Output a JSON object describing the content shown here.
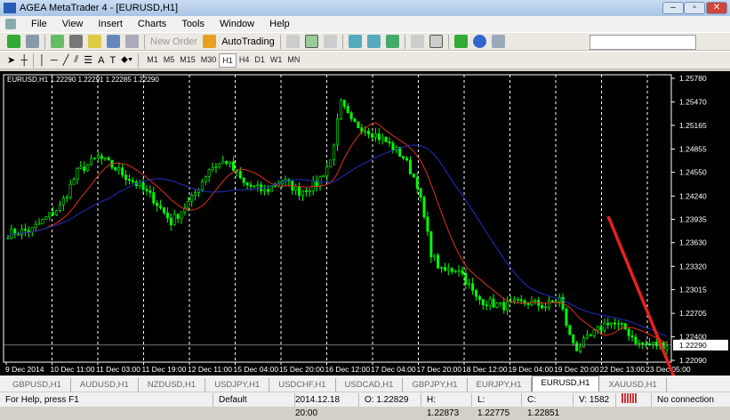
{
  "window": {
    "title": "AGEA MetaTrader 4 - [EURUSD,H1]"
  },
  "menu": [
    "File",
    "View",
    "Insert",
    "Charts",
    "Tools",
    "Window",
    "Help"
  ],
  "toolbar": {
    "new_order": "New Order",
    "autotrading": "AutoTrading",
    "timeframes": [
      "M1",
      "M5",
      "M15",
      "M30",
      "H1",
      "H4",
      "D1",
      "W1",
      "MN"
    ],
    "active_timeframe": "H1",
    "drawing_tools": [
      "cursor",
      "crosshair",
      "vertical-line",
      "horizontal-line",
      "trendline",
      "equidistant-channel",
      "fibonacci",
      "text",
      "text-label",
      "arrows"
    ]
  },
  "chart_data": {
    "type": "candlestick",
    "symbol_info": "EURUSD,H1  1.22290 1.22291 1.22285 1.22290",
    "ylim": [
      1.22,
      1.259
    ],
    "y_ticks": [
      "1.25780",
      "1.25470",
      "1.25165",
      "1.24855",
      "1.24550",
      "1.24240",
      "1.23935",
      "1.23630",
      "1.23320",
      "1.23015",
      "1.22705",
      "1.22400",
      "1.22090"
    ],
    "current_price": "1.22290",
    "x_ticks": [
      "9 Dec 2014",
      "10 Dec 11:00",
      "11 Dec 03:00",
      "11 Dec 19:00",
      "12 Dec 11:00",
      "15 Dec 04:00",
      "15 Dec 20:00",
      "16 Dec 12:00",
      "17 Dec 04:00",
      "17 Dec 20:00",
      "18 Dec 12:00",
      "19 Dec 04:00",
      "19 Dec 20:00",
      "22 Dec 13:00",
      "23 Dec 05:00"
    ],
    "close_path": [
      [
        0,
        1.2375
      ],
      [
        7,
        1.238
      ],
      [
        15,
        1.241
      ],
      [
        20,
        1.2455
      ],
      [
        26,
        1.2475
      ],
      [
        31,
        1.246
      ],
      [
        37,
        1.244
      ],
      [
        42,
        1.242
      ],
      [
        47,
        1.239
      ],
      [
        53,
        1.242
      ],
      [
        58,
        1.246
      ],
      [
        63,
        1.247
      ],
      [
        68,
        1.244
      ],
      [
        74,
        1.243
      ],
      [
        79,
        1.2445
      ],
      [
        84,
        1.243
      ],
      [
        89,
        1.244
      ],
      [
        93,
        1.247
      ],
      [
        96,
        1.2545
      ],
      [
        99,
        1.252
      ],
      [
        104,
        1.251
      ],
      [
        109,
        1.2495
      ],
      [
        114,
        1.2475
      ],
      [
        118,
        1.244
      ],
      [
        122,
        1.235
      ],
      [
        125,
        1.2325
      ],
      [
        130,
        1.233
      ],
      [
        135,
        1.229
      ],
      [
        142,
        1.228
      ],
      [
        150,
        1.2285
      ],
      [
        155,
        1.228
      ],
      [
        159,
        1.229
      ],
      [
        162,
        1.224
      ],
      [
        164,
        1.2225
      ],
      [
        168,
        1.224
      ],
      [
        173,
        1.226
      ],
      [
        178,
        1.225
      ],
      [
        182,
        1.223
      ],
      [
        186,
        1.223
      ],
      [
        190,
        1.2229
      ]
    ],
    "series": [
      {
        "indicator": "moving-average-fast",
        "color": "#e03020"
      },
      {
        "indicator": "moving-average-slow",
        "color": "#2030c0"
      }
    ],
    "candle_color": "#00ff00"
  },
  "tabs": [
    "GBPUSD,H1",
    "AUDUSD,H1",
    "NZDUSD,H1",
    "USDJPY,H1",
    "USDCHF,H1",
    "USDCAD,H1",
    "GBPJPY,H1",
    "EURJPY,H1",
    "EURUSD,H1",
    "XAUUSD,H1"
  ],
  "active_tab": "EURUSD,H1",
  "status": {
    "help": "For Help, press F1",
    "profile": "Default",
    "time": "2014.12.18 20:00",
    "open": "O: 1.22829",
    "high": "H: 1.22873",
    "low": "L: 1.22775",
    "close": "C: 1.22851",
    "volume": "V: 1582",
    "connection": "No connection"
  }
}
